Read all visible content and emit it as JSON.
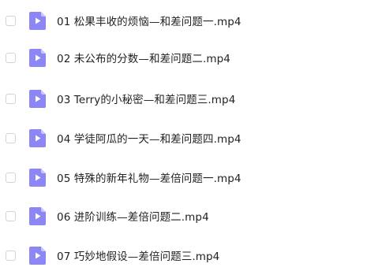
{
  "file_list": {
    "items": [
      {
        "name": "01 松果丰收的烦恼—和差问题一.mp4",
        "icon": "video-file-icon",
        "checked": false
      },
      {
        "name": "02 未公布的分数—和差问题二.mp4",
        "icon": "video-file-icon",
        "checked": false
      },
      {
        "name": "03 Terry的小秘密—和差问题三.mp4",
        "icon": "video-file-icon",
        "checked": false
      },
      {
        "name": "04 学徒阿瓜的一天—和差问题四.mp4",
        "icon": "video-file-icon",
        "checked": false
      },
      {
        "name": "05 特殊的新年礼物—差倍问题一.mp4",
        "icon": "video-file-icon",
        "checked": false
      },
      {
        "name": "06 进阶训练—差倍问题二.mp4",
        "icon": "video-file-icon",
        "checked": false
      },
      {
        "name": "07 巧妙地假设—差倍问题三.mp4",
        "icon": "video-file-icon",
        "checked": false
      }
    ]
  },
  "colors": {
    "icon_fill": "#8c87f5",
    "icon_fold": "#c9c6fb",
    "text": "#222222",
    "checkbox_border": "#d3d3d8"
  }
}
